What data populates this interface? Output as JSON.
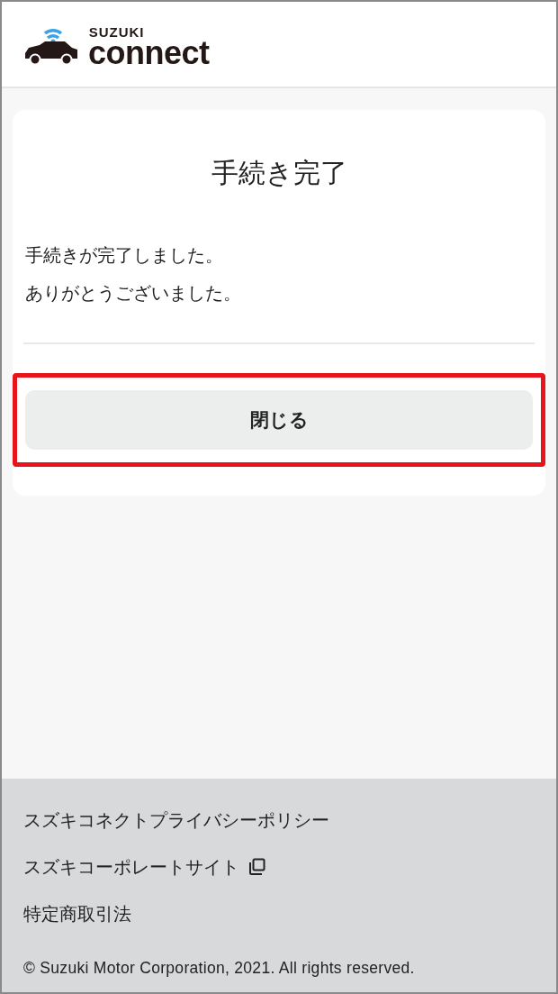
{
  "header": {
    "logo_brand": "SUZUKI",
    "logo_product": "connect"
  },
  "card": {
    "title": "手続き完了",
    "message_lines": [
      "手続きが完了しました。",
      "ありがとうございました。"
    ],
    "button": {
      "label": "閉じる",
      "highlighted": true
    }
  },
  "footer": {
    "links": [
      {
        "label": "スズキコネクトプライバシーポリシー",
        "external": false
      },
      {
        "label": "スズキコーポレートサイト",
        "external": true
      },
      {
        "label": "特定商取引法",
        "external": false
      }
    ],
    "copyright": "© Suzuki Motor Corporation, 2021. All rights reserved."
  }
}
